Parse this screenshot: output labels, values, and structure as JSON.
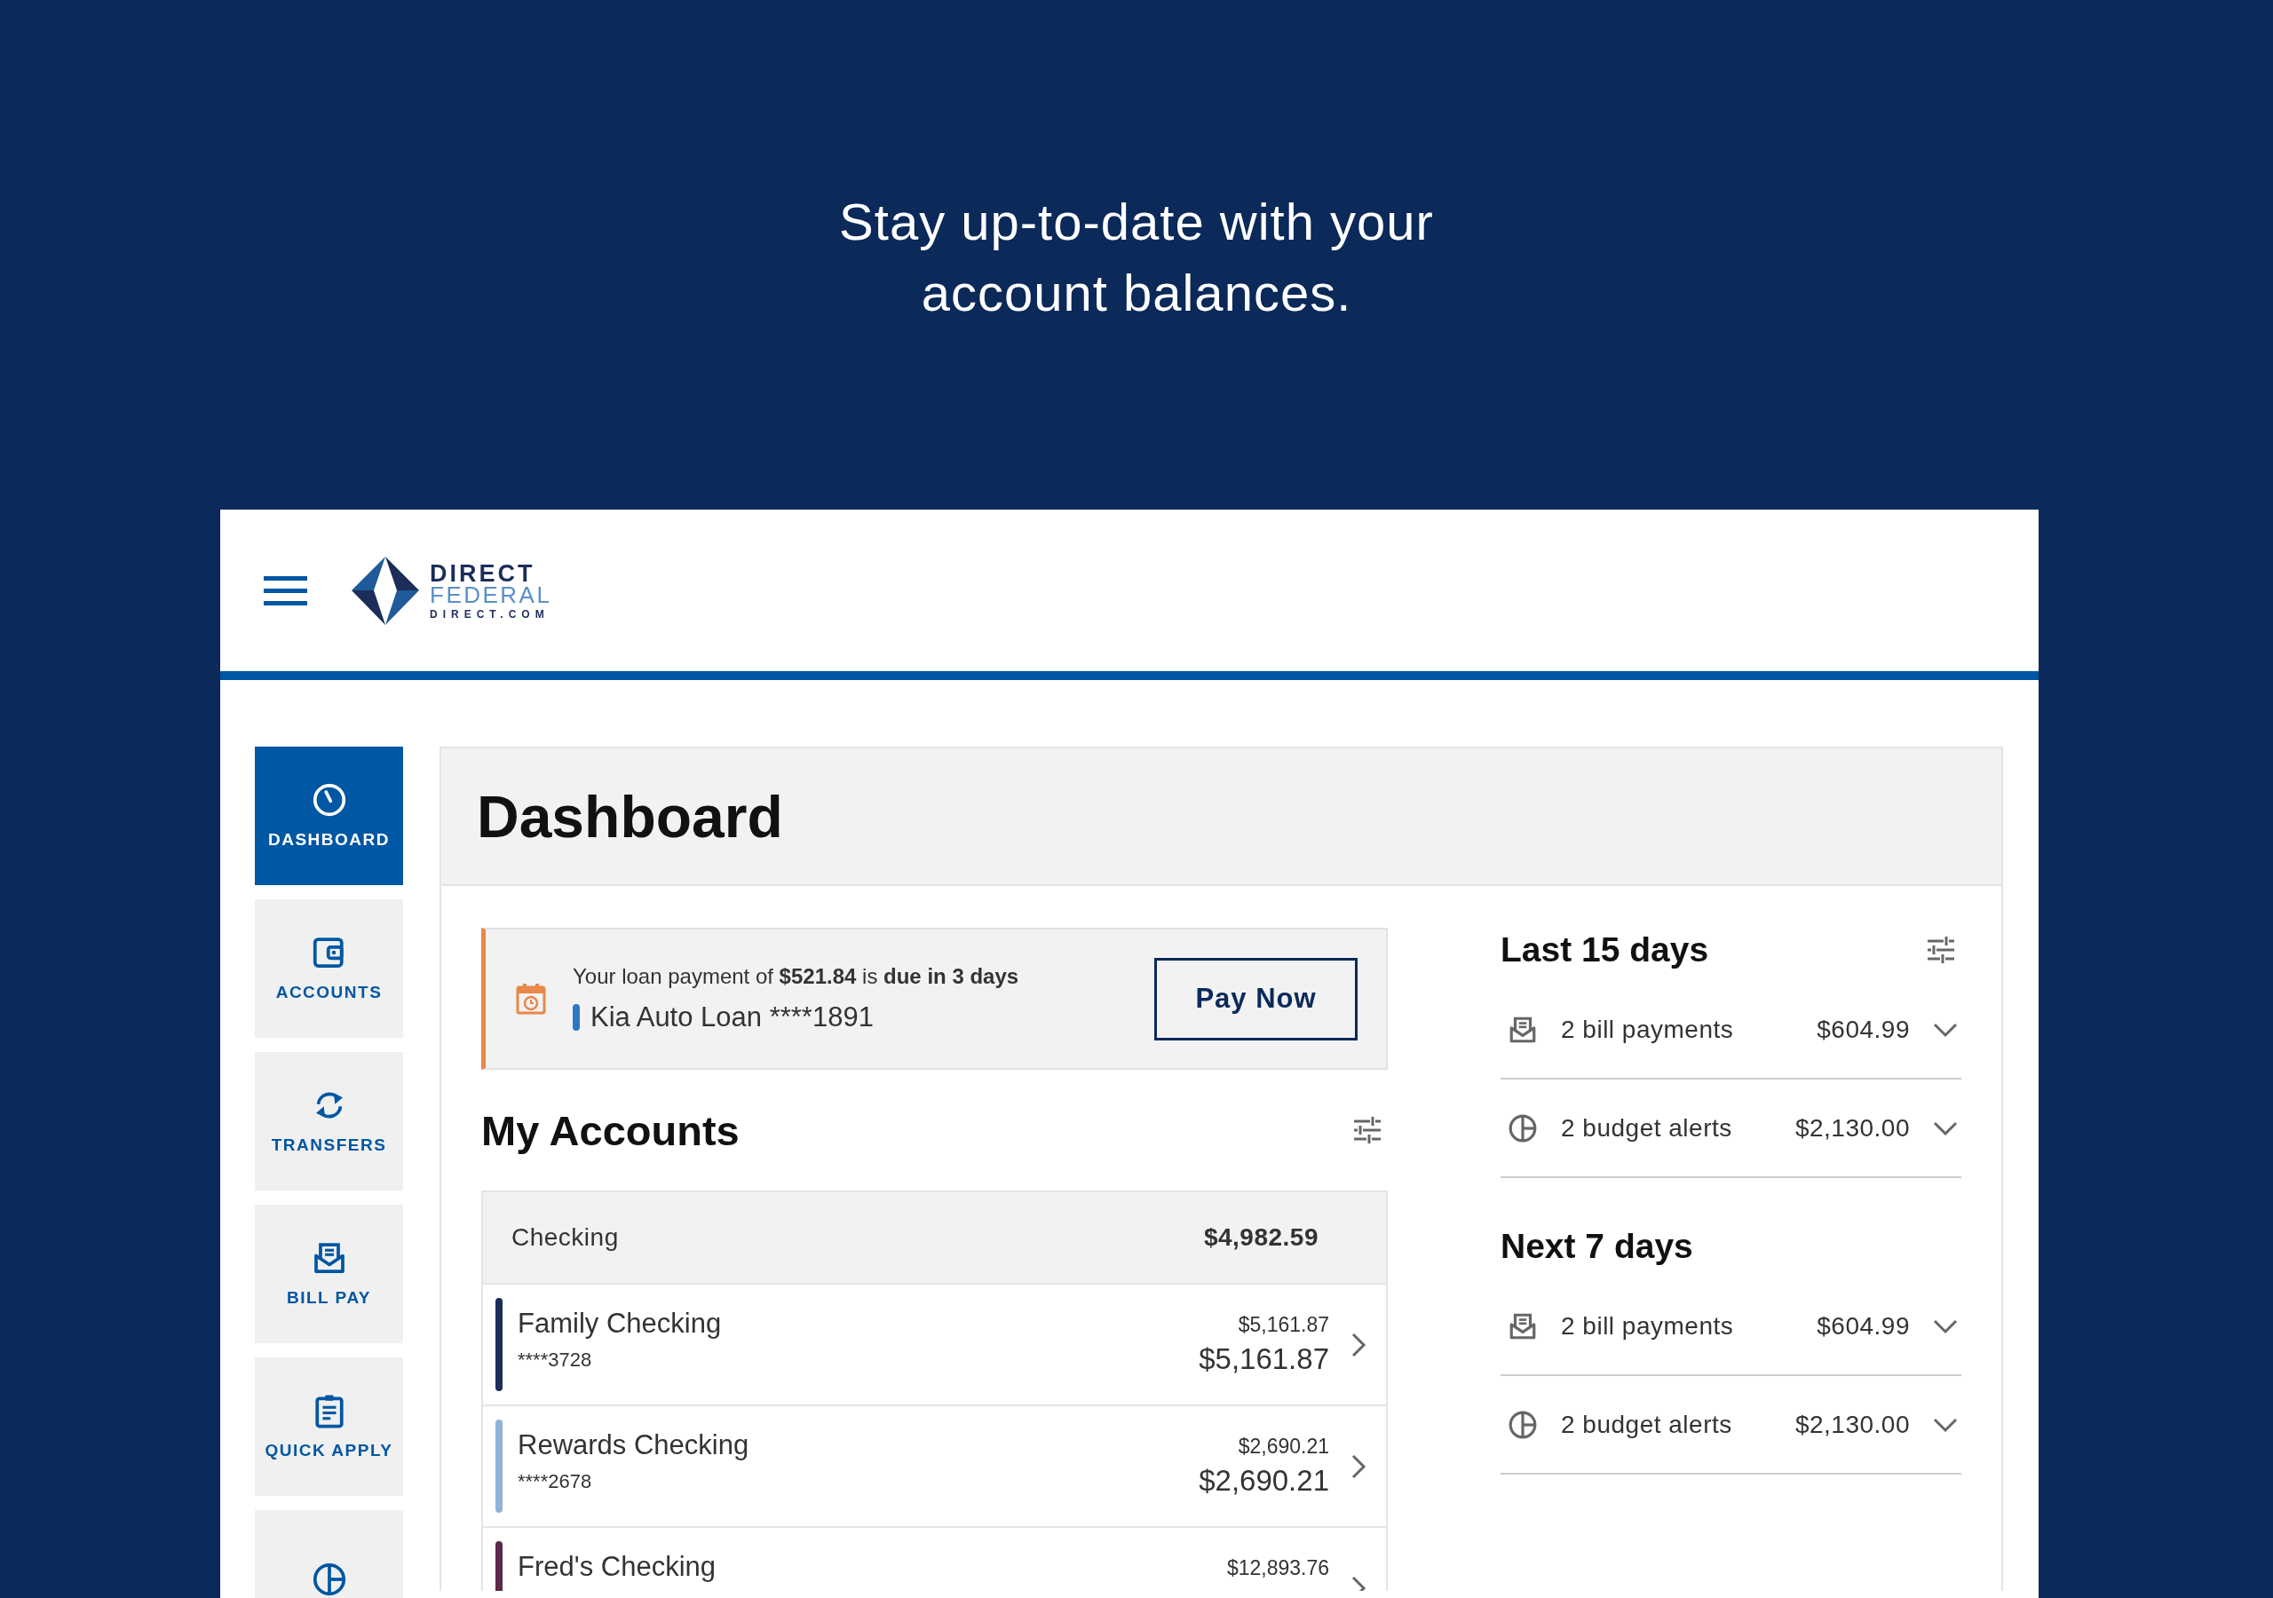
{
  "headline": "Stay up-to-date with your account balances.",
  "header": {
    "logo": {
      "line_1": "DIRECT",
      "line_2": "FEDERAL",
      "line_3": "DIRECT.COM"
    }
  },
  "sidebar": {
    "items": [
      {
        "kind": "gauge",
        "label": "DASHBOARD",
        "selected": true
      },
      {
        "kind": "wallet",
        "label": "ACCOUNTS",
        "selected": false
      },
      {
        "kind": "transfer",
        "label": "TRANSFERS",
        "selected": false
      },
      {
        "kind": "bill",
        "label": "BILL PAY",
        "selected": false
      },
      {
        "kind": "clipboard",
        "label": "QUICK APPLY",
        "selected": false
      },
      {
        "kind": "pie",
        "selected": false
      }
    ]
  },
  "page_title": "Dashboard",
  "alert": {
    "message": "Your loan payment of **$521.84** is **due in 3 days**",
    "account": "Kia Auto Loan ****1891",
    "button": "Pay Now"
  },
  "accounts": {
    "title": "My Accounts",
    "group": {
      "name": "Checking",
      "total": "$4,982.59"
    },
    "rows": [
      {
        "name": "Family Checking",
        "number": "****3728",
        "balance_top": "$5,161.87",
        "balance": "$5,161.87",
        "color": "#1c2d5a"
      },
      {
        "name": "Rewards Checking",
        "number": "****2678",
        "balance_top": "$2,690.21",
        "balance": "$2,690.21",
        "color": "#8fb3d9"
      },
      {
        "name": "Fred's Checking",
        "balance_top": "$12,893.76",
        "color": "#5a2a4a"
      }
    ]
  },
  "summary": [
    {
      "title": "Last 15 days",
      "filter": true,
      "items": [
        {
          "kind": "bill",
          "label": "2 bill payments",
          "amount": "$604.99",
          "expanded": false
        },
        {
          "kind": "pie",
          "label": "2 budget alerts",
          "amount": "$2,130.00",
          "expanded": false
        }
      ]
    },
    {
      "title": "Next 7 days",
      "filter": false,
      "items": [
        {
          "kind": "bill",
          "label": "2 bill payments",
          "amount": "$604.99",
          "expanded": false
        },
        {
          "kind": "pie",
          "label": "2 budget alerts",
          "amount": "$2,130.00",
          "expanded": false
        }
      ]
    }
  ]
}
